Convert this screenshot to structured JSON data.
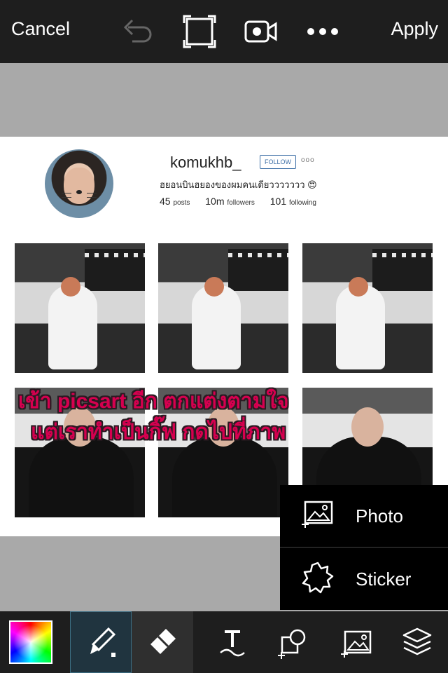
{
  "topbar": {
    "cancel_label": "Cancel",
    "apply_label": "Apply",
    "icons": [
      "undo-icon",
      "crop-frame-icon",
      "video-record-icon",
      "more-icon"
    ]
  },
  "canvas": {
    "profile": {
      "username": "komukhb_",
      "follow_label": "FOLLOW",
      "more": "ooo",
      "bio": "ฮยอนบินฮยองของผมคนเดียววววววว 😍",
      "stats": {
        "posts_count": "45",
        "posts_label": "posts",
        "followers_count": "10m",
        "followers_label": "followers",
        "following_count": "101",
        "following_label": "following"
      }
    },
    "overlay_text": {
      "line1": "เข้า picsart อีก ตกแต่งตามใจ",
      "line2": "แต่เราทำเป็นกิ๊ฟ กดไปที่ภาพ",
      "color": "#d6004f"
    }
  },
  "popup_menu": {
    "items": [
      {
        "label": "Photo",
        "icon": "add-photo-icon"
      },
      {
        "label": "Sticker",
        "icon": "sticker-icon"
      }
    ]
  },
  "bottombar": {
    "tools": [
      "color-picker",
      "brush-tool",
      "eraser-tool",
      "text-tool",
      "shape-add-tool",
      "add-image-tool",
      "layers-tool"
    ],
    "active_tool": "brush-tool",
    "accent": "#3c6e83"
  }
}
